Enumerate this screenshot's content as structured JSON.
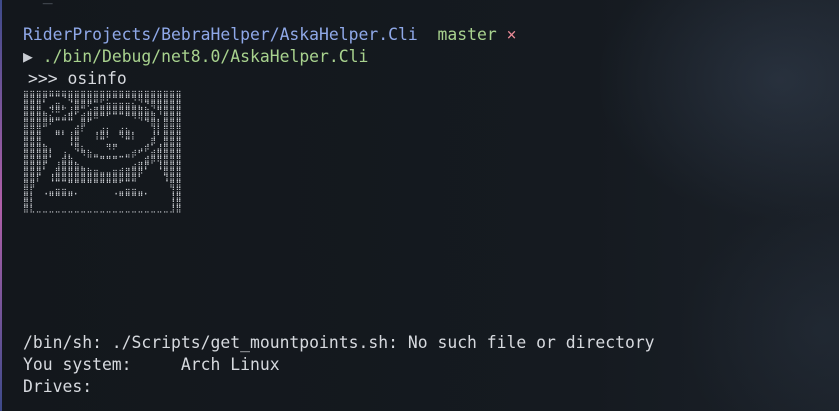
{
  "terminal": {
    "clipped_top": "~ _",
    "path_line": {
      "path": "RiderProjects/BebraHelper/AskaHelper.Cli",
      "branch": "master",
      "status_mark": "×"
    },
    "command_line": {
      "arrow": "▶",
      "command": "./bin/Debug/net8.0/AskaHelper.Cli"
    },
    "app_prompt": {
      "prompt": ">>>",
      "command": "osinfo"
    },
    "ascii_art": "⣿⣿⣿⣿⣿⣿⣿⣿⣿⣿⣿⣿⣿⣿⣿⣿⣿⣿⣿⣿⣿⣿⣿⣿⣿\n⣿⣿⣿⡟⠉⠉⠙⢿⣿⣿⣿⣿⡿⠟⠛⠛⠛⠻⢿⣿⣿⣿⣿⣿⣿\n⣿⣿⣿⠁⣠⣶⣄⠈⣿⣿⠟⢁⣤⣶⣶⣶⣶⣦⣄⠙⢿⣿⣿⣿⣿\n⣿⣿⣿⡄⠹⠿⠃⣸⡿⠁⣴⣿⣿⣿⣿⣿⣿⣿⣿⣷⡄⢻⣿⣿⣿\n⣿⣿⣿⣿⣦⣤⣴⣿⠁⣾⣿⠿⠛⠋⠉⠉⠛⠻⢿⣿⣿⡀⣿⣿⣿\n⣿⣿⣿⣿⠟⠉⠉⠉⢀⣿⠋⠀⠀⠀⠀⠀⠀⠀⠀⠙⣿⡇⣿⣿⣿\n⣿⣿⣿⠁⠀⣤⡄⠀⣾⠇⠀⢀⣴⡆⠀⣴⣦⡀⠀⠀⢸⡇⣿⣿⣿\n⣿⣿⣿⠀⠀⠛⠃⢸⣿⠀⠀⢸⣿⠇⠀⠻⣿⡇⠀⠀⢸⠃⣿⣿⣿\n⣿⣿⣿⡀⠀⠀⠀⢸⣿⠀⠀⠀⠉⢀⣀⠀⠉⠀⠀⢀⡿⢀⣿⣿⣿\n⣿⣿⣿⣷⡄⠀⠀⠈⢿⣆⠀⠀⠀⠻⠟⠀⠀⠀⣠⡾⠁⣼⣿⣿⣿\n⣿⣿⣿⣿⡇⠀⢰⡄⠈⠻⣷⣤⣀⣀⣀⣀⣤⡾⠋⢀⣾⣿⣿⣿⣿\n⣿⣿⣿⣿⠁⠀⣾⣷⡀⠀⠀⠉⠛⠛⠛⠉⠁⠀⢀⣾⡿⢿⣿⣿⣿\n⣿⣿⣿⡏⠀⢸⣿⣿⣷⣄⠀⠀⠀⠀⠀⠀⢀⣴⣿⡟⠀⢸⣿⣿⣿\n⣿⣿⣿⠁⢀⣿⣿⣿⣿⣿⣷⣶⣤⣤⣶⣾⣿⣿⡿⠁⠀⠈⣿⣿⣿\n⣿⣿⡏⠀⢸⣿⣿⣿⣿⣿⣿⣿⣿⣿⣿⣿⣿⣿⠃⠀⠀⠀⢹⣿⣿\n⣿⣿⠀⠀⠈⠉⠉⠛⠛⠛⠛⠛⠛⠛⠛⠋⠉⠁⠀⠀⠀⠀⠈⣿⣿\n⣿⡇⠀⢀⣤⣶⣶⣤⡀⠀⠀⠀⠀⠀⢀⣤⣶⣶⣤⡀⠀⠀⠀⢸⣿\n⣿⡇⠀⠈⠛⠛⠛⠛⠁⠀⠀⠀⠀⠀⠈⠛⠛⠛⠛⠁⠀⠀⠀⢸⣿\n⣿⡇⠀⠀⠀⠀⠀⠀⠀⠀⠀⠀⠀⠀⠀⠀⠀⠀⠀⠀⠀⠀⠀⢸⣿\n⣿⣇⣀⣀⣀⣀⣀⣀⣀⣀⣀⣀⣀⣀⣀⣀⣀⣀⣀⣀⣀⣀⣀⣸⣿",
    "error_line": "/bin/sh: ./Scripts/get_mountpoints.sh: No such file or directory",
    "system_info": {
      "label": "You system:",
      "value": "Arch Linux"
    },
    "drives": {
      "label": "Drives:"
    }
  },
  "colors": {
    "background": "#14181e",
    "path": "#8fa8e8",
    "branch": "#a8d28e",
    "status_mark": "#e88a96",
    "text": "#d6d9de"
  }
}
